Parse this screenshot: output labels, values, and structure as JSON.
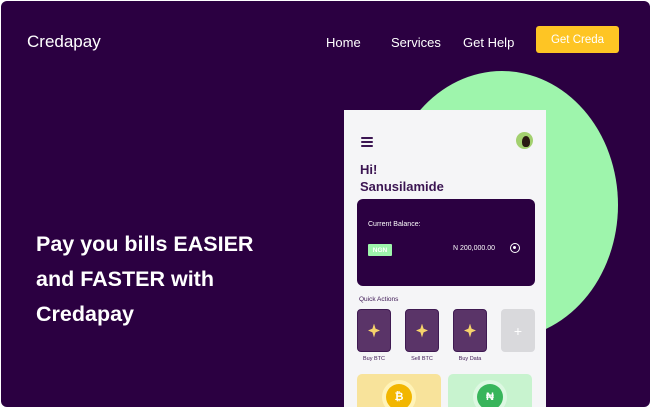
{
  "header": {
    "logo": "Credapay",
    "nav": [
      "Home",
      "Services",
      "Get Help"
    ],
    "cta_label": "Get Creda"
  },
  "hero": {
    "headline_lines": [
      "Pay you bills EASIER",
      "and FASTER with",
      "Credapay"
    ]
  },
  "phone": {
    "greeting": "Hi!",
    "user_name": "Sanusilamide",
    "balance_label": "Current Balance:",
    "currency_badge": "NGN",
    "balance_amount": "N 200,000.00",
    "quick_actions_title": "Quick Actions",
    "quick_actions": [
      "Buy BTC",
      "Sell BTC",
      "Buy Data"
    ],
    "add_action": "+",
    "coins": [
      "₿",
      "₦"
    ]
  },
  "colors": {
    "background": "#2b0041",
    "accent": "#fec524",
    "mint": "#9ef5ac"
  }
}
